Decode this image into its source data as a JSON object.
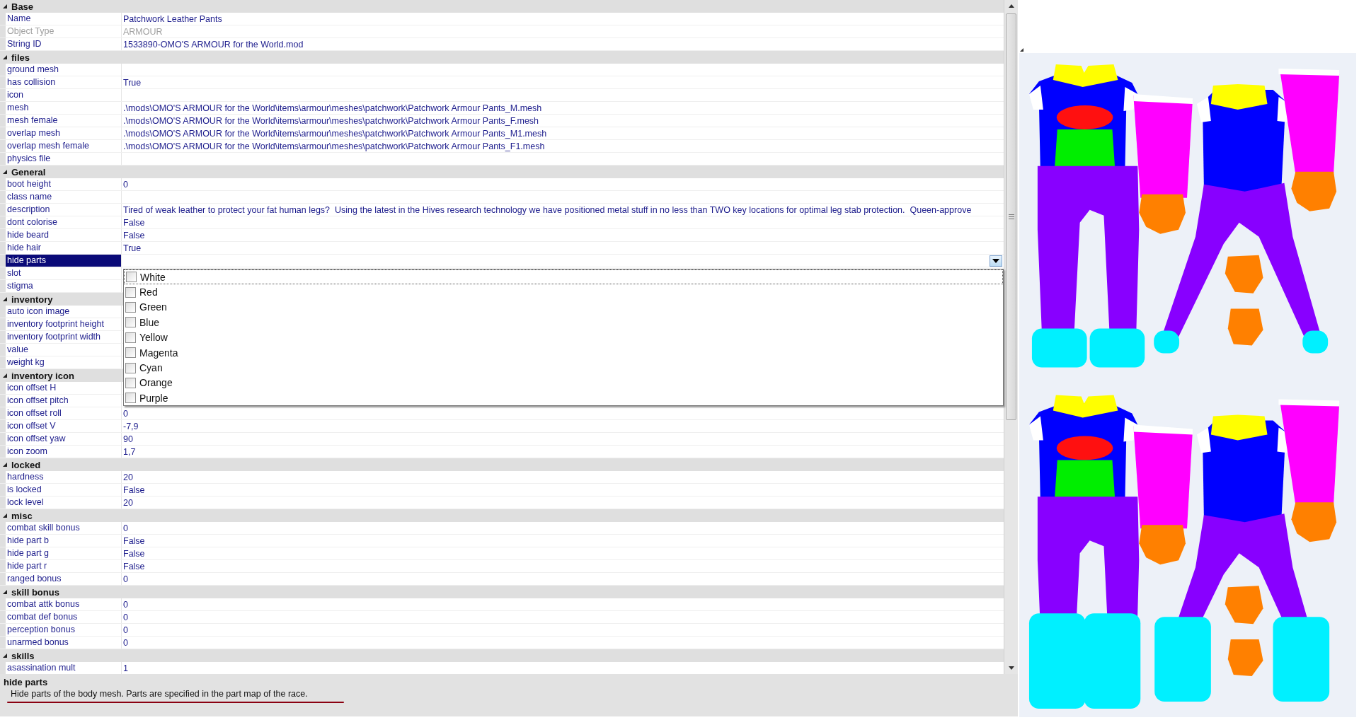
{
  "groups": [
    {
      "title": "Base",
      "expanded": true,
      "rows": [
        {
          "name": "Name",
          "value": "Patchwork Leather Pants",
          "disabled": false,
          "selected": false
        },
        {
          "name": "Object Type",
          "value": "ARMOUR",
          "disabled": true,
          "selected": false
        },
        {
          "name": "String ID",
          "value": "1533890-OMO'S ARMOUR for the World.mod",
          "disabled": false,
          "selected": false
        }
      ]
    },
    {
      "title": "files",
      "expanded": true,
      "rows": [
        {
          "name": "ground mesh",
          "value": "",
          "disabled": false,
          "selected": false
        },
        {
          "name": "has collision",
          "value": "True",
          "disabled": false,
          "selected": false
        },
        {
          "name": "icon",
          "value": "",
          "disabled": false,
          "selected": false
        },
        {
          "name": "mesh",
          "value": ".\\mods\\OMO'S ARMOUR for the World\\items\\armour\\meshes\\patchwork\\Patchwork Armour Pants_M.mesh",
          "disabled": false,
          "selected": false
        },
        {
          "name": "mesh female",
          "value": ".\\mods\\OMO'S ARMOUR for the World\\items\\armour\\meshes\\patchwork\\Patchwork Armour Pants_F.mesh",
          "disabled": false,
          "selected": false
        },
        {
          "name": "overlap mesh",
          "value": ".\\mods\\OMO'S ARMOUR for the World\\items\\armour\\meshes\\patchwork\\Patchwork Armour Pants_M1.mesh",
          "disabled": false,
          "selected": false
        },
        {
          "name": "overlap mesh female",
          "value": ".\\mods\\OMO'S ARMOUR for the World\\items\\armour\\meshes\\patchwork\\Patchwork Armour Pants_F1.mesh",
          "disabled": false,
          "selected": false
        },
        {
          "name": "physics file",
          "value": "",
          "disabled": false,
          "selected": false
        }
      ]
    },
    {
      "title": "General",
      "expanded": true,
      "rows": [
        {
          "name": "boot height",
          "value": "0",
          "disabled": false,
          "selected": false
        },
        {
          "name": "class name",
          "value": "",
          "disabled": false,
          "selected": false
        },
        {
          "name": "description",
          "value": "Tired of weak leather to protect your fat human legs?  Using the latest in the Hives research technology we have positioned metal stuff in no less than TWO key locations for optimal leg stab protection.  Queen-approve",
          "disabled": false,
          "selected": false
        },
        {
          "name": "dont colorise",
          "value": "False",
          "disabled": false,
          "selected": false
        },
        {
          "name": "hide beard",
          "value": "False",
          "disabled": false,
          "selected": false
        },
        {
          "name": "hide hair",
          "value": "True",
          "disabled": false,
          "selected": false
        },
        {
          "name": "hide parts",
          "value": "",
          "disabled": false,
          "selected": true,
          "kind": "dropdown"
        },
        {
          "name": "slot",
          "value": "",
          "disabled": false,
          "selected": false
        },
        {
          "name": "stigma",
          "value": "",
          "disabled": false,
          "selected": false
        }
      ]
    },
    {
      "title": "inventory",
      "expanded": true,
      "rows": [
        {
          "name": "auto icon image",
          "value": "",
          "disabled": false,
          "selected": false
        },
        {
          "name": "inventory footprint height",
          "value": "",
          "disabled": false,
          "selected": false
        },
        {
          "name": "inventory footprint width",
          "value": "",
          "disabled": false,
          "selected": false
        },
        {
          "name": "value",
          "value": "",
          "disabled": false,
          "selected": false
        },
        {
          "name": "weight kg",
          "value": "",
          "disabled": false,
          "selected": false
        }
      ]
    },
    {
      "title": "inventory icon",
      "expanded": true,
      "rows": [
        {
          "name": "icon offset H",
          "value": "",
          "disabled": false,
          "selected": false
        },
        {
          "name": "icon offset pitch",
          "value": "",
          "disabled": false,
          "selected": false
        },
        {
          "name": "icon offset roll",
          "value": "0",
          "disabled": false,
          "selected": false
        },
        {
          "name": "icon offset V",
          "value": "-7,9",
          "disabled": false,
          "selected": false
        },
        {
          "name": "icon offset yaw",
          "value": "90",
          "disabled": false,
          "selected": false
        },
        {
          "name": "icon zoom",
          "value": "1,7",
          "disabled": false,
          "selected": false
        }
      ]
    },
    {
      "title": "locked",
      "expanded": true,
      "rows": [
        {
          "name": "hardness",
          "value": "20",
          "disabled": false,
          "selected": false
        },
        {
          "name": "is locked",
          "value": "False",
          "disabled": false,
          "selected": false
        },
        {
          "name": "lock level",
          "value": "20",
          "disabled": false,
          "selected": false
        }
      ]
    },
    {
      "title": "misc",
      "expanded": true,
      "rows": [
        {
          "name": "combat skill bonus",
          "value": "0",
          "disabled": false,
          "selected": false
        },
        {
          "name": "hide part b",
          "value": "False",
          "disabled": false,
          "selected": false
        },
        {
          "name": "hide part g",
          "value": "False",
          "disabled": false,
          "selected": false
        },
        {
          "name": "hide part r",
          "value": "False",
          "disabled": false,
          "selected": false
        },
        {
          "name": "ranged bonus",
          "value": "0",
          "disabled": false,
          "selected": false
        }
      ]
    },
    {
      "title": "skill bonus",
      "expanded": true,
      "rows": [
        {
          "name": "combat attk bonus",
          "value": "0",
          "disabled": false,
          "selected": false
        },
        {
          "name": "combat def bonus",
          "value": "0",
          "disabled": false,
          "selected": false
        },
        {
          "name": "perception bonus",
          "value": "0",
          "disabled": false,
          "selected": false
        },
        {
          "name": "unarmed bonus",
          "value": "0",
          "disabled": false,
          "selected": false
        }
      ]
    },
    {
      "title": "skills",
      "expanded": true,
      "rows": [
        {
          "name": "asassination mult",
          "value": "1",
          "disabled": false,
          "selected": false
        }
      ]
    }
  ],
  "dropdown": {
    "options": [
      {
        "label": "White",
        "checked": false
      },
      {
        "label": "Red",
        "checked": false
      },
      {
        "label": "Green",
        "checked": false
      },
      {
        "label": "Blue",
        "checked": false
      },
      {
        "label": "Yellow",
        "checked": false
      },
      {
        "label": "Magenta",
        "checked": false
      },
      {
        "label": "Cyan",
        "checked": false
      },
      {
        "label": "Orange",
        "checked": false
      },
      {
        "label": "Purple",
        "checked": false
      }
    ]
  },
  "help": {
    "title": "hide parts",
    "text": "Hide parts of the body mesh. Parts are specified in the part map of the race."
  }
}
